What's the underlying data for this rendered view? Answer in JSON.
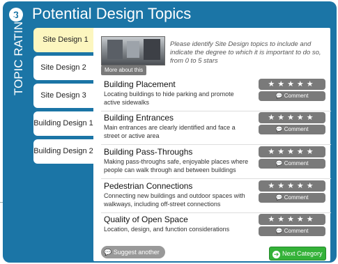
{
  "header": {
    "step": "3",
    "title": "Potential Design Topics"
  },
  "side_label": "TOPIC RATING",
  "tabs": [
    {
      "label": "Site Design 1",
      "active": true
    },
    {
      "label": "Site Design 2",
      "active": false
    },
    {
      "label": "Site Design 3",
      "active": false
    },
    {
      "label": "Building Design 1",
      "active": false
    },
    {
      "label": "Building Design 2",
      "active": false
    }
  ],
  "intro": {
    "text": "Please identify Site Design topics to include and indicate the degree to which it is important to do so, from 0 to 5 stars",
    "more_label": "More about this"
  },
  "stars_glyph": "★★★★★",
  "comment_label": "💬 Comment",
  "topics": [
    {
      "title": "Building Placement",
      "desc": "Locating buildings to hide parking and promote active sidewalks"
    },
    {
      "title": "Building Entrances",
      "desc": "Main entrances are clearly identified and face a street or active area"
    },
    {
      "title": "Building Pass-Throughs",
      "desc": "Making pass-throughs safe, enjoyable places where people can walk through and between buildings"
    },
    {
      "title": "Pedestrian Connections",
      "desc": "Connecting new buildings and outdoor spaces with walkways, including off-street connections"
    },
    {
      "title": "Quality of Open Space",
      "desc": "Location, design, and function considerations"
    }
  ],
  "footer": {
    "suggest_label": "💬 Suggest another",
    "next_label": "Next Category"
  },
  "colors": {
    "frame": "#1b75a6",
    "active_tab": "#fcf6bf",
    "next": "#34b238",
    "control": "#7a7a7a"
  }
}
